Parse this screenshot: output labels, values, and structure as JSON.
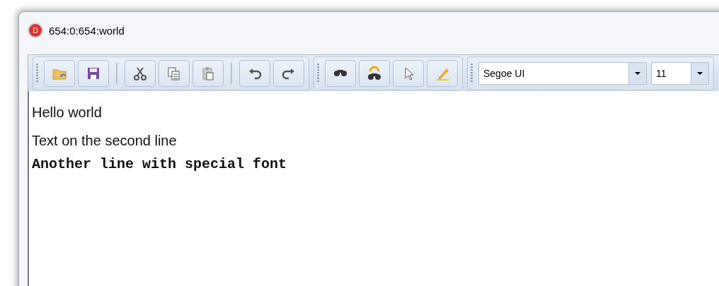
{
  "window": {
    "icon_letter": "D",
    "title": "654:0:654:world"
  },
  "toolbar": {
    "groups": [
      {
        "kind": "buttons",
        "items": [
          {
            "kind": "open"
          },
          {
            "kind": "save"
          },
          {
            "kind": "separator"
          },
          {
            "kind": "cut"
          },
          {
            "kind": "copy"
          },
          {
            "kind": "paste"
          },
          {
            "kind": "separator"
          },
          {
            "kind": "undo"
          },
          {
            "kind": "redo"
          }
        ]
      },
      {
        "kind": "buttons",
        "items": [
          {
            "kind": "find"
          },
          {
            "kind": "replace"
          },
          {
            "kind": "pointer"
          },
          {
            "kind": "highlight"
          }
        ]
      },
      {
        "kind": "font",
        "font": "Segoe UI",
        "size": "11"
      }
    ]
  },
  "editor": {
    "lines": [
      {
        "kind": "normal",
        "text": "Hello world"
      },
      {
        "kind": "normal",
        "text": "Text on the second line"
      },
      {
        "kind": "mono",
        "text": "Another line with special font"
      }
    ]
  }
}
